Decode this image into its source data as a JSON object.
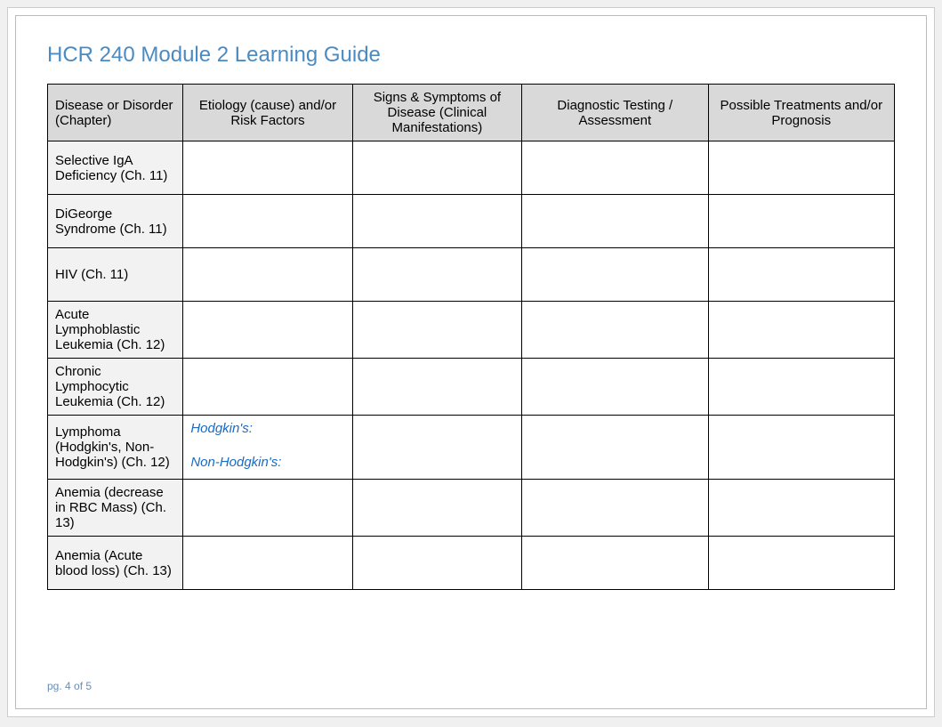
{
  "title": "HCR 240 Module 2 Learning Guide",
  "headers": {
    "c1": "Disease or Disorder (Chapter)",
    "c2": "Etiology (cause) and/or Risk Factors",
    "c3": "Signs & Symptoms of Disease (Clinical Manifestations)",
    "c4": "Diagnostic Testing / Assessment",
    "c5": "Possible Treatments and/or Prognosis"
  },
  "rows": [
    {
      "disease": "Selective IgA Deficiency (Ch. 11)",
      "etiology": "",
      "signs": "",
      "diag": "",
      "treat": ""
    },
    {
      "disease": "DiGeorge Syndrome (Ch. 11)",
      "etiology": "",
      "signs": "",
      "diag": "",
      "treat": ""
    },
    {
      "disease": "HIV (Ch. 11)",
      "etiology": "",
      "signs": "",
      "diag": "",
      "treat": ""
    },
    {
      "disease": "Acute Lymphoblastic Leukemia (Ch. 12)",
      "etiology": "",
      "signs": "",
      "diag": "",
      "treat": ""
    },
    {
      "disease": "Chronic Lymphocytic Leukemia (Ch. 12)",
      "etiology": "",
      "signs": "",
      "diag": "",
      "treat": ""
    },
    {
      "disease": "Lymphoma (Hodgkin's, Non-Hodgkin's) (Ch. 12)",
      "etiology_a": "Hodgkin's:",
      "etiology_b": "Non-Hodgkin's:",
      "signs": "",
      "diag": "",
      "treat": ""
    },
    {
      "disease": "Anemia (decrease in RBC Mass) (Ch. 13)",
      "etiology": "",
      "signs": "",
      "diag": "",
      "treat": ""
    },
    {
      "disease": "Anemia (Acute blood loss) (Ch. 13)",
      "etiology": "",
      "signs": "",
      "diag": "",
      "treat": ""
    }
  ],
  "page_number": "pg. 4 of 5"
}
